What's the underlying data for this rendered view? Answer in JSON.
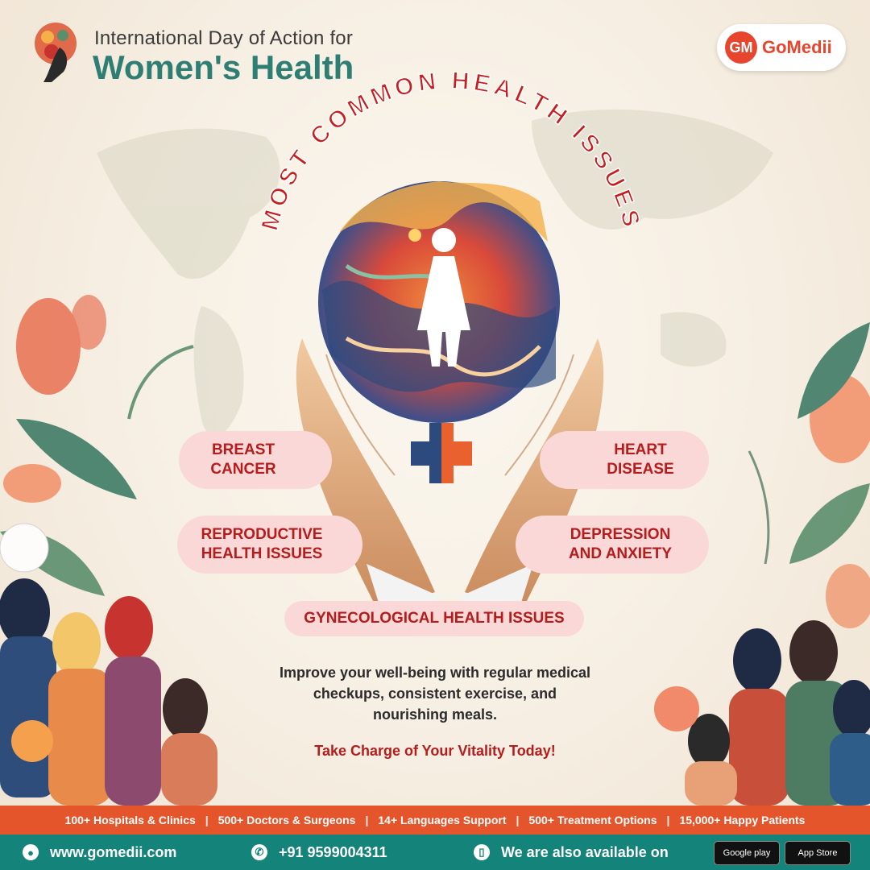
{
  "header": {
    "subtitle": "International Day of Action for",
    "title": "Women's Health",
    "logo_mark": "GM",
    "logo_text": "GoMedii"
  },
  "arc_title": "MOST COMMON HEALTH ISSUES",
  "issues": {
    "breast": [
      "BREAST",
      "CANCER"
    ],
    "heart": [
      "HEART",
      "DISEASE"
    ],
    "reproductive": [
      "REPRODUCTIVE",
      "HEALTH ISSUES"
    ],
    "depression": [
      "DEPRESSION",
      "AND ANXIETY"
    ],
    "gynecological": "GYNECOLOGICAL HEALTH ISSUES"
  },
  "body_text": "Improve your well-being with regular medical checkups, consistent exercise, and nourishing meals.",
  "cta": "Take Charge of Your Vitality Today!",
  "stats": [
    "100+ Hospitals & Clinics",
    "500+ Doctors & Surgeons",
    "14+ Languages Support",
    "500+ Treatment Options",
    "15,000+ Happy Patients"
  ],
  "contact": {
    "website": "www.gomedii.com",
    "phone": "+91 9599004311",
    "available": "We are also available on",
    "google_play": "Google play",
    "app_store": "App Store"
  },
  "icons": [
    "globe-icon",
    "whatsapp-icon",
    "phone-app-icon",
    "female-figure-icon",
    "medical-cross-icon"
  ],
  "colors": {
    "teal": "#2f7e74",
    "red": "#b51c1c",
    "orange_bar": "#e5552b",
    "teal_bar": "#14837a",
    "pill_pink": "#fbd8d8"
  }
}
